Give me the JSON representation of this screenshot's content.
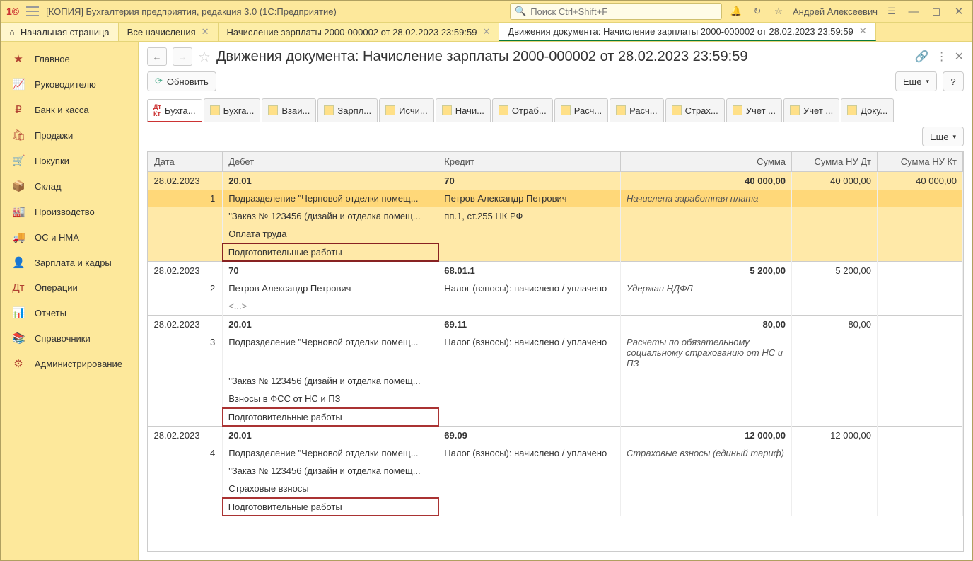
{
  "titlebar": {
    "app_title": "[КОПИЯ] Бухгалтерия предприятия, редакция 3.0  (1С:Предприятие)",
    "search_placeholder": "Поиск Ctrl+Shift+F",
    "user": "Андрей Алексеевич"
  },
  "top_tabs": {
    "home": "Начальная страница",
    "t1": "Все начисления",
    "t2": "Начисление зарплаты 2000-000002 от 28.02.2023 23:59:59",
    "t3": "Движения документа: Начисление зарплаты 2000-000002 от 28.02.2023 23:59:59"
  },
  "sidebar": [
    {
      "icon": "★",
      "label": "Главное"
    },
    {
      "icon": "📈",
      "label": "Руководителю"
    },
    {
      "icon": "₽",
      "label": "Банк и касса"
    },
    {
      "icon": "🛍",
      "label": "Продажи"
    },
    {
      "icon": "🛒",
      "label": "Покупки"
    },
    {
      "icon": "📦",
      "label": "Склад"
    },
    {
      "icon": "🏭",
      "label": "Производство"
    },
    {
      "icon": "🚚",
      "label": "ОС и НМА"
    },
    {
      "icon": "👤",
      "label": "Зарплата и кадры"
    },
    {
      "icon": "Дт",
      "label": "Операции"
    },
    {
      "icon": "📊",
      "label": "Отчеты"
    },
    {
      "icon": "📚",
      "label": "Справочники"
    },
    {
      "icon": "⚙",
      "label": "Администрирование"
    }
  ],
  "page": {
    "title": "Движения документа: Начисление зарплаты 2000-000002 от 28.02.2023 23:59:59",
    "refresh": "Обновить",
    "more": "Еще",
    "help": "?"
  },
  "reg_tabs": [
    "Бухга...",
    "Бухга...",
    "Взаи...",
    "Зарпл...",
    "Исчи...",
    "Начи...",
    "Отраб...",
    "Расч...",
    "Расч...",
    "Страх...",
    "Учет ...",
    "Учет ...",
    "Доку..."
  ],
  "table": {
    "headers": {
      "date": "Дата",
      "debit": "Дебет",
      "credit": "Кредит",
      "sum": "Сумма",
      "sum_nu_dt": "Сумма НУ Дт",
      "sum_nu_kt": "Сумма НУ Кт"
    },
    "rows": [
      {
        "n": "1",
        "date": "28.02.2023",
        "hl": true,
        "debit_acc": "20.01",
        "credit_acc": "70",
        "sum": "40 000,00",
        "nu_dt": "40 000,00",
        "nu_kt": "40 000,00",
        "debit_lines": [
          "Подразделение \"Черновой отделки помещ...",
          "\"Заказ № 123456 (дизайн и отделка помещ...",
          "Оплата труда",
          "Подготовительные работы"
        ],
        "credit_lines": [
          "Петров Александр Петрович",
          "пп.1, ст.255 НК РФ"
        ],
        "desc": "Начислена заработная плата",
        "red_last": true,
        "dark_red": true,
        "selected": true
      },
      {
        "n": "2",
        "date": "28.02.2023",
        "debit_acc": "70",
        "credit_acc": "68.01.1",
        "sum": "5 200,00",
        "nu_dt": "5 200,00",
        "nu_kt": "",
        "debit_lines": [
          "Петров Александр Петрович",
          "<...>"
        ],
        "credit_lines": [
          "Налог (взносы): начислено / уплачено"
        ],
        "desc": "Удержан НДФЛ",
        "red_last": false
      },
      {
        "n": "3",
        "date": "28.02.2023",
        "debit_acc": "20.01",
        "credit_acc": "69.11",
        "sum": "80,00",
        "nu_dt": "80,00",
        "nu_kt": "",
        "debit_lines": [
          "Подразделение \"Черновой отделки помещ...",
          "\"Заказ № 123456 (дизайн и отделка помещ...",
          "Взносы в ФСС от НС и ПЗ",
          "Подготовительные работы"
        ],
        "credit_lines": [
          "Налог (взносы): начислено / уплачено"
        ],
        "desc": "Расчеты по обязательному социальному страхованию от НС и ПЗ",
        "red_last": true
      },
      {
        "n": "4",
        "date": "28.02.2023",
        "debit_acc": "20.01",
        "credit_acc": "69.09",
        "sum": "12 000,00",
        "nu_dt": "12 000,00",
        "nu_kt": "",
        "debit_lines": [
          "Подразделение \"Черновой отделки помещ...",
          "\"Заказ № 123456 (дизайн и отделка помещ...",
          "Страховые взносы",
          "Подготовительные работы"
        ],
        "credit_lines": [
          "Налог (взносы): начислено / уплачено"
        ],
        "desc": "Страховые взносы (единый тариф)",
        "red_last": true
      }
    ]
  }
}
